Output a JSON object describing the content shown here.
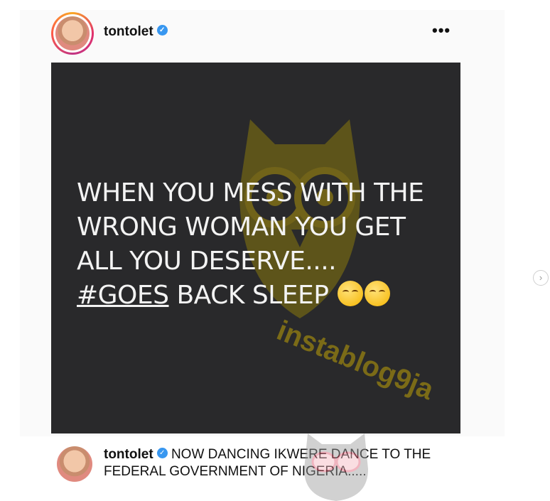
{
  "post": {
    "username": "tontolet",
    "more_label": "•••",
    "verified_icon": "verified-badge-icon"
  },
  "image": {
    "lines": [
      "WHEN YOU MESS WITH THE",
      "WRONG WOMAN YOU GET",
      "ALL YOU DESERVE...."
    ],
    "hashtag": "#GOES",
    "line_end": " BACK SLEEP",
    "emoji_icon": "smiling-face-emoji",
    "watermark_text": "instablog9ja"
  },
  "nav": {
    "next_label": "›"
  },
  "caption": {
    "username": "tontolet",
    "text": "NOW DANCING IKWERE DANCE TO THE FEDERAL GOVERNMENT OF NIGERIA....."
  },
  "colors": {
    "image_bg": "#29292b",
    "text": "#f3f3f3",
    "watermark": "#8a7714",
    "verified": "#3897f0"
  }
}
